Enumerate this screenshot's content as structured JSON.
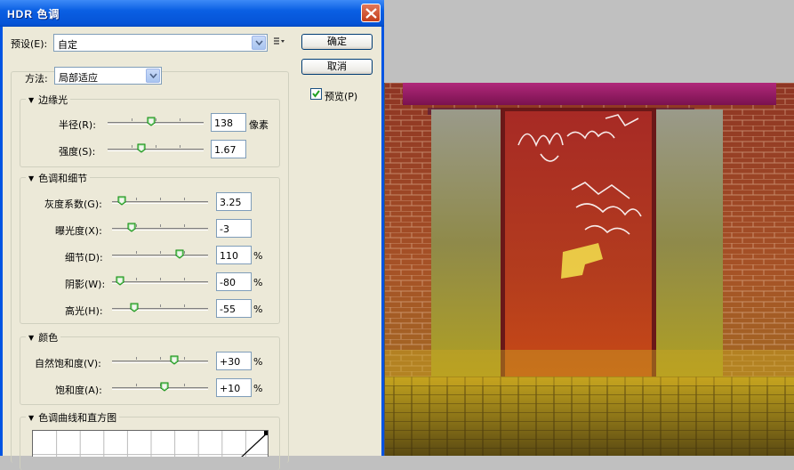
{
  "window": {
    "title": "HDR 色调",
    "close_icon": "close-icon"
  },
  "preset": {
    "label": "预设(E):",
    "value": "自定",
    "menu_icon": "preset-menu-icon"
  },
  "buttons": {
    "ok": "确定",
    "cancel": "取消"
  },
  "preview": {
    "label": "预览(P)",
    "checked": true
  },
  "method": {
    "label": "方法:",
    "value": "局部适应"
  },
  "edge_glow": {
    "title": "边缘光",
    "radius": {
      "label": "半径(R):",
      "value": "138",
      "unit": "像素",
      "level": 0.45
    },
    "strength": {
      "label": "强度(S):",
      "value": "1.67",
      "unit": "",
      "level": 0.35
    }
  },
  "tone_detail": {
    "title": "色调和细节",
    "gamma": {
      "label": "灰度系数(G):",
      "value": "3.25",
      "unit": "",
      "level": 0.1
    },
    "exposure": {
      "label": "曝光度(X):",
      "value": "-3",
      "unit": "",
      "level": 0.2
    },
    "detail": {
      "label": "细节(D):",
      "value": "110",
      "unit": "%",
      "level": 0.7
    },
    "shadow": {
      "label": "阴影(W):",
      "value": "-80",
      "unit": "%",
      "level": 0.08
    },
    "highlight": {
      "label": "高光(H):",
      "value": "-55",
      "unit": "%",
      "level": 0.23
    }
  },
  "color": {
    "title": "颜色",
    "vibrance": {
      "label": "自然饱和度(V):",
      "value": "+30",
      "unit": "%",
      "level": 0.65
    },
    "saturation": {
      "label": "饱和度(A):",
      "value": "+10",
      "unit": "%",
      "level": 0.55
    }
  },
  "curve": {
    "title": "色调曲线和直方图"
  },
  "colors": {
    "title_bar": "#0a5fe3",
    "dialog_bg": "#ece9d8",
    "accent": "#316ac5"
  }
}
